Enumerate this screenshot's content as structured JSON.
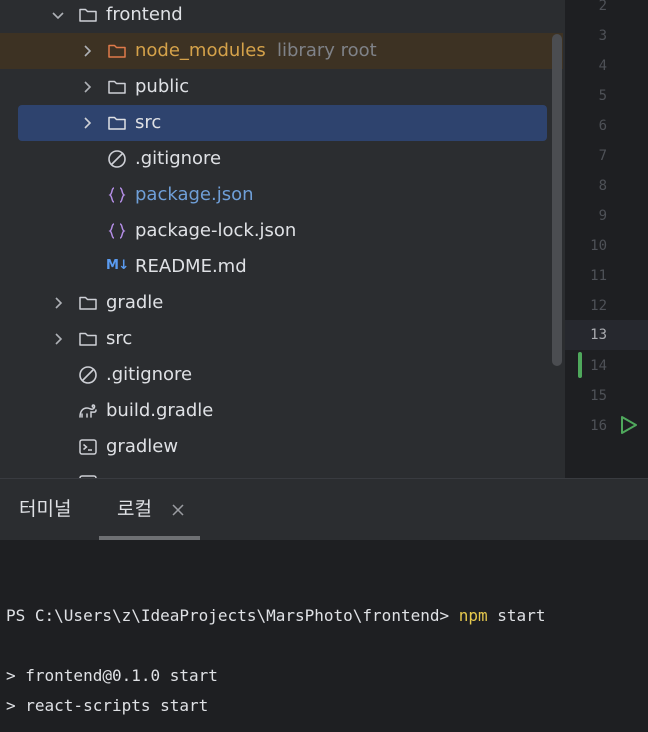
{
  "tree": {
    "items": [
      {
        "label": "frontend",
        "depth": 1,
        "expanded": true,
        "type": "folder"
      },
      {
        "label": "node_modules",
        "hint": "library root",
        "depth": 2,
        "expanded": false,
        "type": "folder-excluded"
      },
      {
        "label": "public",
        "depth": 2,
        "expanded": false,
        "type": "folder"
      },
      {
        "label": "src",
        "depth": 2,
        "expanded": false,
        "type": "folder",
        "selected": true
      },
      {
        "label": ".gitignore",
        "depth": 2,
        "type": "ignore-file"
      },
      {
        "label": "package.json",
        "depth": 2,
        "type": "json-file",
        "modified": true
      },
      {
        "label": "package-lock.json",
        "depth": 2,
        "type": "json-file"
      },
      {
        "label": "README.md",
        "depth": 2,
        "type": "markdown-file",
        "icon_text": "M↓"
      },
      {
        "label": "gradle",
        "depth": 1,
        "expanded": false,
        "type": "folder"
      },
      {
        "label": "src",
        "depth": 1,
        "expanded": false,
        "type": "folder"
      },
      {
        "label": ".gitignore",
        "depth": 1,
        "type": "ignore-file"
      },
      {
        "label": "build.gradle",
        "depth": 1,
        "type": "gradle-file"
      },
      {
        "label": "gradlew",
        "depth": 1,
        "type": "shell-file"
      }
    ]
  },
  "gutter": {
    "lines": [
      "2",
      "3",
      "4",
      "5",
      "6",
      "7",
      "8",
      "9",
      "10",
      "11",
      "12",
      "13",
      "14",
      "15",
      "16"
    ],
    "current_line": "13"
  },
  "terminal": {
    "tabs": [
      {
        "label": "터미널"
      },
      {
        "label": "로컬",
        "active": true
      }
    ],
    "prompt": "PS C:\\Users\\z\\IdeaProjects\\MarsPhoto\\frontend> ",
    "command": "npm start",
    "output": [
      "> frontend@0.1.0 start",
      "> react-scripts start"
    ]
  },
  "colors": {
    "tree_bg": "#2b2d30",
    "selection": "#2e436e",
    "excluded_bg": "#3d3223",
    "excluded_text": "#d5a24a",
    "modified_text": "#6f9fd8",
    "command": "#e5c84d",
    "vcs_added": "#4fa85c"
  }
}
